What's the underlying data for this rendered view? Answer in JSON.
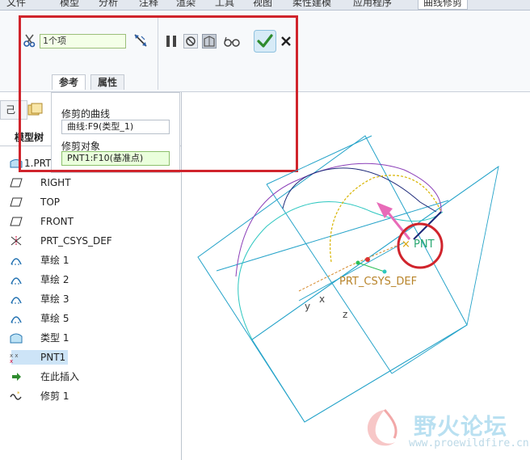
{
  "menu_tabs": [
    "文件",
    "模型",
    "分析",
    "注释",
    "渲染",
    "工具",
    "视图",
    "柔性建模",
    "应用程序",
    "曲线修剪"
  ],
  "active_tab": "曲线修剪",
  "dashboard": {
    "selection_field": "1个项",
    "panel_tabs": [
      "参考",
      "属性"
    ],
    "active_panel_tab": "参考",
    "trimmed_curve_label": "修剪的曲线",
    "trimmed_curve_value": "曲线:F9(类型_1)",
    "trim_object_label": "修剪对象",
    "trim_object_value": "PNT1:F10(基准点)"
  },
  "tree": {
    "header": "模型树",
    "items": [
      {
        "label": "1.PRT",
        "icon": "part-icon"
      },
      {
        "label": "RIGHT",
        "icon": "datum-plane-icon"
      },
      {
        "label": "TOP",
        "icon": "datum-plane-icon"
      },
      {
        "label": "FRONT",
        "icon": "datum-plane-icon"
      },
      {
        "label": "PRT_CSYS_DEF",
        "icon": "coordinate-system-icon"
      },
      {
        "label": "草绘 1",
        "icon": "sketch-icon"
      },
      {
        "label": "草绘 2",
        "icon": "sketch-icon"
      },
      {
        "label": "草绘 3",
        "icon": "sketch-icon"
      },
      {
        "label": "草绘 5",
        "icon": "sketch-icon"
      },
      {
        "label": "类型 1",
        "icon": "surface-icon"
      },
      {
        "label": "PNT1",
        "icon": "datum-point-icon"
      },
      {
        "label": "在此插入",
        "icon": "insert-here-icon"
      },
      {
        "label": "修剪 1",
        "icon": "curve-trim-icon"
      }
    ],
    "selected_index": 10
  },
  "viewport": {
    "point_label": "PNT",
    "csys_label": "PRT_CSYS_DEF",
    "axis_x": "x",
    "axis_y": "y",
    "axis_z": "z"
  },
  "watermark": {
    "name": "野火论坛",
    "url": "www.proewildfire.cn"
  },
  "colors": {
    "highlight": "#d0242c",
    "plane": "#25a3c9",
    "ok_green": "#2e8b2e",
    "arrow_pink": "#e86bb8"
  }
}
